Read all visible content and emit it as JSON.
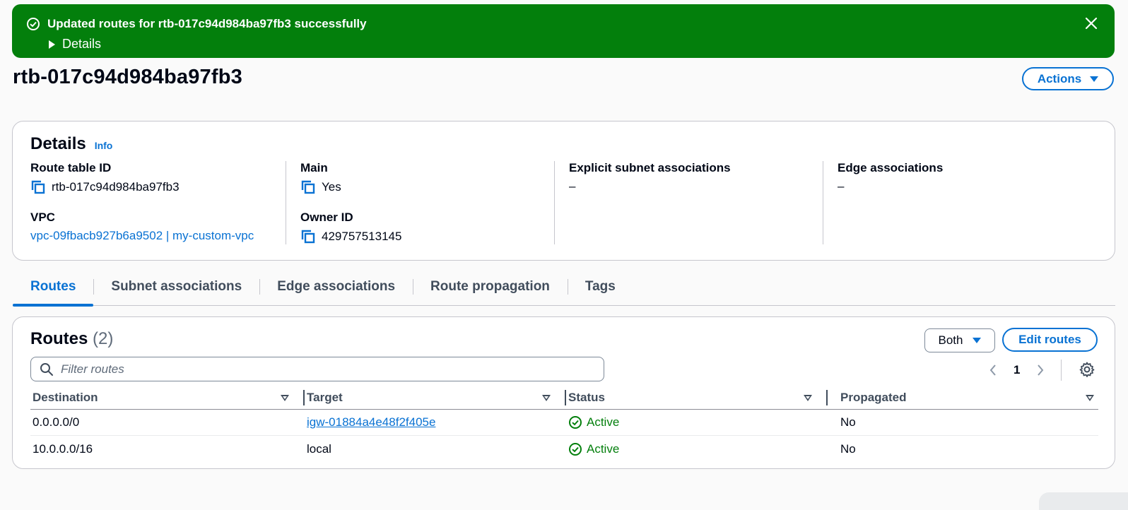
{
  "flash": {
    "message": "Updated routes for rtb-017c94d984ba97fb3 successfully",
    "details_label": "Details",
    "color": "#037f0c"
  },
  "header": {
    "title": "rtb-017c94d984ba97fb3",
    "actions_label": "Actions"
  },
  "details": {
    "heading": "Details",
    "info_label": "Info",
    "route_table_id_label": "Route table ID",
    "route_table_id": "rtb-017c94d984ba97fb3",
    "vpc_label": "VPC",
    "vpc_value": "vpc-09fbacb927b6a9502 | my-custom-vpc",
    "main_label": "Main",
    "main_value": "Yes",
    "owner_label": "Owner ID",
    "owner_value": "429757513145",
    "explicit_label": "Explicit subnet associations",
    "explicit_value": "–",
    "edge_label": "Edge associations",
    "edge_value": "–"
  },
  "tabs": [
    {
      "label": "Routes",
      "active": true
    },
    {
      "label": "Subnet associations",
      "active": false
    },
    {
      "label": "Edge associations",
      "active": false
    },
    {
      "label": "Route propagation",
      "active": false
    },
    {
      "label": "Tags",
      "active": false
    }
  ],
  "routes": {
    "heading": "Routes",
    "count": "(2)",
    "filter_select": "Both",
    "edit_label": "Edit routes",
    "filter_placeholder": "Filter routes",
    "page": "1",
    "columns": [
      "Destination",
      "Target",
      "Status",
      "Propagated"
    ],
    "rows": [
      {
        "destination": "0.0.0.0/0",
        "target": "igw-01884a4e48f2f405e",
        "status": "Active",
        "propagated": "No"
      },
      {
        "destination": "10.0.0.0/16",
        "target": "local",
        "status": "Active",
        "propagated": "No"
      }
    ]
  },
  "colors": {
    "accent": "#0972d3",
    "success": "#037f0c"
  }
}
